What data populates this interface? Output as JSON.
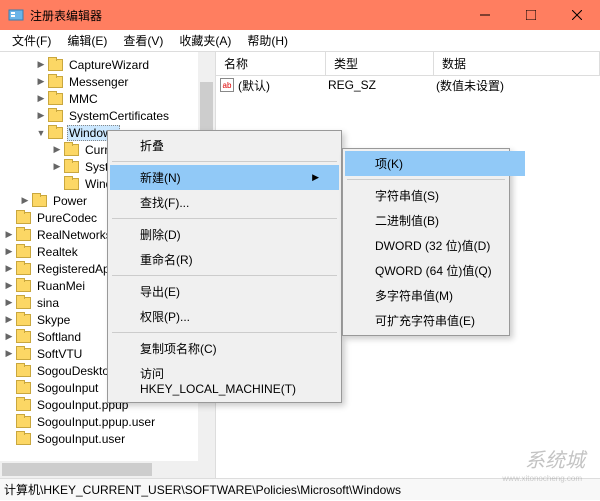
{
  "title": "注册表编辑器",
  "menubar": [
    "文件(F)",
    "编辑(E)",
    "查看(V)",
    "收藏夹(A)",
    "帮助(H)"
  ],
  "tree": [
    {
      "ind": 2,
      "toggle": ">",
      "label": "CaptureWizard"
    },
    {
      "ind": 2,
      "toggle": ">",
      "label": "Messenger"
    },
    {
      "ind": 2,
      "toggle": ">",
      "label": "MMC"
    },
    {
      "ind": 2,
      "toggle": ">",
      "label": "SystemCertificates"
    },
    {
      "ind": 2,
      "toggle": "v",
      "label": "Windows",
      "selected": true
    },
    {
      "ind": 3,
      "toggle": ">",
      "label": "Curre"
    },
    {
      "ind": 3,
      "toggle": ">",
      "label": "Syste"
    },
    {
      "ind": 3,
      "toggle": "",
      "label": "Windows"
    },
    {
      "ind": 1,
      "toggle": ">",
      "label": "Power"
    },
    {
      "ind": 0,
      "toggle": "",
      "label": "PureCodec"
    },
    {
      "ind": 0,
      "toggle": ">",
      "label": "RealNetworks"
    },
    {
      "ind": 0,
      "toggle": ">",
      "label": "Realtek"
    },
    {
      "ind": 0,
      "toggle": ">",
      "label": "RegisteredAppl"
    },
    {
      "ind": 0,
      "toggle": ">",
      "label": "RuanMei"
    },
    {
      "ind": 0,
      "toggle": ">",
      "label": "sina"
    },
    {
      "ind": 0,
      "toggle": ">",
      "label": "Skype"
    },
    {
      "ind": 0,
      "toggle": ">",
      "label": "Softland"
    },
    {
      "ind": 0,
      "toggle": ">",
      "label": "SoftVTU"
    },
    {
      "ind": 0,
      "toggle": "",
      "label": "SogouDesktopBar"
    },
    {
      "ind": 0,
      "toggle": "",
      "label": "SogouInput"
    },
    {
      "ind": 0,
      "toggle": "",
      "label": "SogouInput.ppup"
    },
    {
      "ind": 0,
      "toggle": "",
      "label": "SogouInput.ppup.user"
    },
    {
      "ind": 0,
      "toggle": "",
      "label": "SogouInput.user"
    }
  ],
  "list": {
    "headers": {
      "name": "名称",
      "type": "类型",
      "data": "数据"
    },
    "rows": [
      {
        "icon": "ab",
        "name": "(默认)",
        "type": "REG_SZ",
        "data": "(数值未设置)"
      }
    ]
  },
  "ctx_main": [
    {
      "label": "折叠",
      "type": "item"
    },
    {
      "type": "sep"
    },
    {
      "label": "新建(N)",
      "type": "item",
      "hl": true,
      "arrow": true
    },
    {
      "label": "查找(F)...",
      "type": "item"
    },
    {
      "type": "sep"
    },
    {
      "label": "删除(D)",
      "type": "item"
    },
    {
      "label": "重命名(R)",
      "type": "item"
    },
    {
      "type": "sep"
    },
    {
      "label": "导出(E)",
      "type": "item"
    },
    {
      "label": "权限(P)...",
      "type": "item"
    },
    {
      "type": "sep"
    },
    {
      "label": "复制项名称(C)",
      "type": "item"
    },
    {
      "label": "访问 HKEY_LOCAL_MACHINE(T)",
      "type": "item"
    }
  ],
  "ctx_sub": [
    {
      "label": "项(K)",
      "hl": true
    },
    {
      "type": "sep"
    },
    {
      "label": "字符串值(S)"
    },
    {
      "label": "二进制值(B)"
    },
    {
      "label": "DWORD (32 位)值(D)"
    },
    {
      "label": "QWORD (64 位)值(Q)"
    },
    {
      "label": "多字符串值(M)"
    },
    {
      "label": "可扩充字符串值(E)"
    }
  ],
  "statusbar": "计算机\\HKEY_CURRENT_USER\\SOFTWARE\\Policies\\Microsoft\\Windows",
  "watermark": "系统城",
  "watermark_sub": "www.xitonocheng.com"
}
